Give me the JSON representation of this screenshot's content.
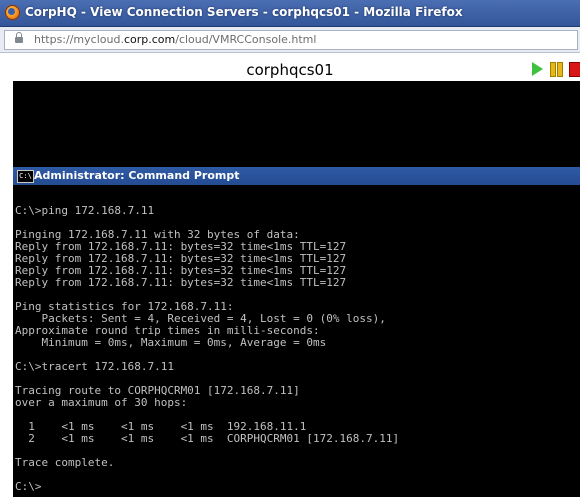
{
  "browser": {
    "title": "CorpHQ - View Connection Servers - corphqcs01 - Mozilla Firefox",
    "url_prefix": "https://mycloud.",
    "url_domain": "corp.com",
    "url_suffix": "/cloud/VMRCConsole.html"
  },
  "console": {
    "vm_name": "corphqcs01"
  },
  "cmd": {
    "title": "Administrator: Command Prompt",
    "icon_text": "C:\\",
    "lines": [
      "",
      "C:\\>ping 172.168.7.11",
      "",
      "Pinging 172.168.7.11 with 32 bytes of data:",
      "Reply from 172.168.7.11: bytes=32 time<1ms TTL=127",
      "Reply from 172.168.7.11: bytes=32 time<1ms TTL=127",
      "Reply from 172.168.7.11: bytes=32 time<1ms TTL=127",
      "Reply from 172.168.7.11: bytes=32 time<1ms TTL=127",
      "",
      "Ping statistics for 172.168.7.11:",
      "    Packets: Sent = 4, Received = 4, Lost = 0 (0% loss),",
      "Approximate round trip times in milli-seconds:",
      "    Minimum = 0ms, Maximum = 0ms, Average = 0ms",
      "",
      "C:\\>tracert 172.168.7.11",
      "",
      "Tracing route to CORPHQCRM01 [172.168.7.11]",
      "over a maximum of 30 hops:",
      "",
      "  1    <1 ms    <1 ms    <1 ms  192.168.11.1",
      "  2    <1 ms    <1 ms    <1 ms  CORPHQCRM01 [172.168.7.11]",
      "",
      "Trace complete.",
      "",
      "C:\\>"
    ]
  },
  "icons": {
    "browser": "firefox-icon",
    "lock": "lock-icon",
    "play": "play-icon",
    "pause": "pause-icon",
    "stop": "stop-icon"
  },
  "colors": {
    "window_title": "#33559a",
    "cmd_title": "#2f5aa5",
    "terminal_bg": "#000000",
    "terminal_text": "#c0c0c0",
    "play": "#3ec13e",
    "pause": "#e8b716",
    "stop": "#d91616"
  }
}
